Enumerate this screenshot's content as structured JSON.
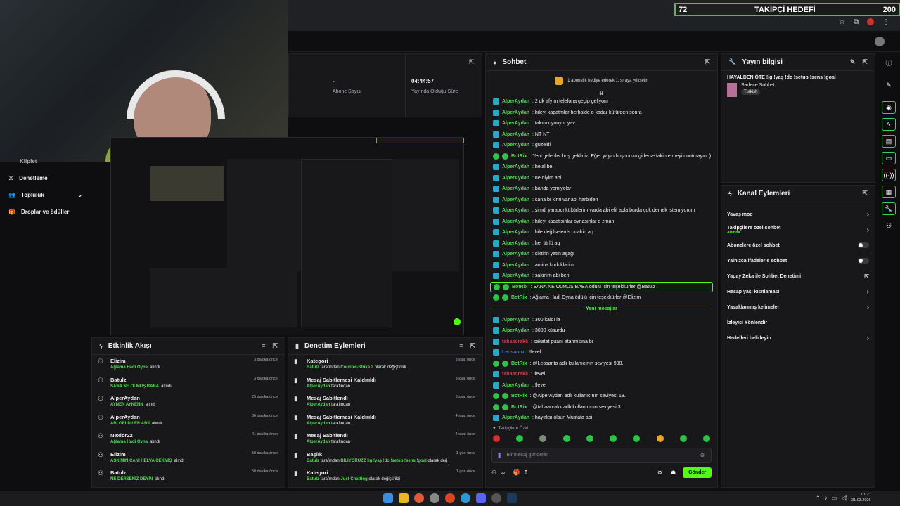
{
  "goal": {
    "current": "72",
    "title": "TAKİPÇİ HEDEFİ",
    "target": "200"
  },
  "left_nav": {
    "items": [
      {
        "label": "Kliplet"
      },
      {
        "label": "Denetleme"
      },
      {
        "label": "Topluluk"
      },
      {
        "label": "Droplar ve ödüller"
      }
    ]
  },
  "stats": {
    "abone_value": "-",
    "abone_label": "Abone Sayısı",
    "time_value": "04:44:57",
    "time_label": "Yayında Olduğu Süre"
  },
  "chat": {
    "title": "Sohbet",
    "gift_banner": "1 abonelik hediye ederek 1. sıraya yükselin",
    "messages": [
      {
        "user": "AlperAydan",
        "text": ": 2 dk afyım telefona geçip geliyom",
        "bot": false
      },
      {
        "user": "AlperAydan",
        "text": ": hileyi kapatmlar herhalde o kadar küfürden sonra",
        "bot": false
      },
      {
        "user": "AlperAydan",
        "text": ": takım oynuyor yav",
        "bot": false
      },
      {
        "user": "AlperAydan",
        "text": ": NT NT",
        "bot": false
      },
      {
        "user": "AlperAydan",
        "text": ": güzeldi",
        "bot": false
      },
      {
        "user": "BotRix",
        "text": ": Yeni gelenler hoş geldiniz. Eğer yayın hoşunuza giderse takip etmeyi unutmayın :)",
        "bot": true
      },
      {
        "user": "AlperAydan",
        "text": ": helal be",
        "bot": false
      },
      {
        "user": "AlperAydan",
        "text": ": ne diyim abi",
        "bot": false
      },
      {
        "user": "AlperAydan",
        "text": ": banda yemiyolar",
        "bot": false
      },
      {
        "user": "AlperAydan",
        "text": ": sana bi kiriri var abi harbiden",
        "bot": false
      },
      {
        "user": "AlperAydan",
        "text": ": şimdi yaratıcı kültürlerim varda abi elif abla burda çok demek istemiyorum",
        "bot": false
      },
      {
        "user": "AlperAydan",
        "text": ": hileyi kaoatisinlar oynasınlar o zman",
        "bot": false
      },
      {
        "user": "AlperAydan",
        "text": ": hile değilselerds onalrin aq",
        "bot": false
      },
      {
        "user": "AlperAydan",
        "text": ": her türlü aq",
        "bot": false
      },
      {
        "user": "AlperAydan",
        "text": ": siktirin yatın aşağı",
        "bot": false
      },
      {
        "user": "AlperAydan",
        "text": ": amina koduklarim",
        "bot": false
      },
      {
        "user": "AlperAydan",
        "text": ": sakinim abi ben",
        "bot": false
      },
      {
        "user": "BotRix",
        "text": ": SANA NE OLMUŞ BABA ödülü için teşekkürler @Batulz",
        "bot": true,
        "highlight": true
      },
      {
        "user": "BotRix",
        "text": ": Ağlama Hadi Oyna ödülü için teşekkürler @Elizim",
        "bot": true
      }
    ],
    "new_messages_label": "Yeni mesajlar",
    "messages2": [
      {
        "user": "AlperAydan",
        "text": ": 300 kaldı la",
        "bot": false,
        "color": "#56d856"
      },
      {
        "user": "AlperAydan",
        "text": ": 3000 küsurdu",
        "bot": false,
        "color": "#56d856"
      },
      {
        "user": "tahaaoraklı",
        "text": ": sakatat puanı atarmısına bı",
        "bot": false,
        "color": "#e0364a"
      },
      {
        "user": "Leosanto",
        "text": ": !level",
        "bot": false,
        "color": "#3b7bf0"
      },
      {
        "user": "BotRix",
        "text": ": @Leosanto adlı kullanıcının seviyesi 998.",
        "bot": true,
        "color": "#56d856"
      },
      {
        "user": "tahaaoraklı",
        "text": ": !level",
        "bot": false,
        "color": "#e0364a"
      },
      {
        "user": "AlperAydan",
        "text": ": !level",
        "bot": false,
        "color": "#56d856"
      },
      {
        "user": "BotRix",
        "text": ": @AlperAydan adlı kullanıcının seviyesi 18.",
        "bot": true,
        "color": "#56d856"
      },
      {
        "user": "BotRix",
        "text": ": @tahaaorakk adlı kullanıcının seviyesi 3.",
        "bot": true,
        "color": "#56d856"
      },
      {
        "user": "AlperAydan",
        "text": ": hayırlısı olsun Mustafa abi",
        "bot": false,
        "color": "#56d856"
      }
    ],
    "followers_only": "Takipçilere Özel",
    "input_placeholder": "Bir mesaj gönderin",
    "points": "0",
    "send_label": "Gönder"
  },
  "stream_info": {
    "title": "Yayın bilgisi",
    "stream_title": "HAYALDEN ÖTE !ig !yaş !dc !setup !sens !goal",
    "category": "Sadece Sohbet",
    "tag": "Turkish"
  },
  "channel_actions": {
    "title": "Kanal Eylemleri",
    "items": [
      {
        "label": "Yavaş mod",
        "sub": "",
        "ctrl": "chevron"
      },
      {
        "label": "Takipçilere özel sohbet",
        "sub": "Anında",
        "ctrl": "chevron"
      },
      {
        "label": "Abonelere özel sohbet",
        "sub": "",
        "ctrl": "toggle"
      },
      {
        "label": "Yalnızca ifadelerle sohbet",
        "sub": "",
        "ctrl": "toggle"
      },
      {
        "label": "Yapay Zeka ile Sohbet Denetimi",
        "sub": "",
        "ctrl": "external"
      },
      {
        "label": "Hesap yaşı kısıtlaması",
        "sub": "",
        "ctrl": "chevron"
      },
      {
        "label": "Yasaklanmış kelimeler",
        "sub": "",
        "ctrl": "chevron"
      },
      {
        "label": "İzleyici Yönlendir",
        "sub": "",
        "ctrl": "none"
      },
      {
        "label": "Hedefleri belirleyin",
        "sub": "",
        "ctrl": "chevron"
      }
    ]
  },
  "activity": {
    "title": "Etkinlik Akışı",
    "items": [
      {
        "user": "Elizim",
        "reward": "Ağlama Hadi Oyna",
        "suffix": "alındı",
        "time": "3 dakika önce"
      },
      {
        "user": "Batulz",
        "reward": "SANA NE OLMUŞ BABA",
        "suffix": "alındı",
        "time": "3 dakika önce"
      },
      {
        "user": "AlperAydan",
        "reward": "AYNEN AYNENN",
        "suffix": "alındı",
        "time": "25 dakika önce"
      },
      {
        "user": "AlperAydan",
        "reward": "ABİ GELDİLER ABİİ",
        "suffix": "alındı",
        "time": "36 dakika önce"
      },
      {
        "user": "Nexlor22",
        "reward": "Ağlama Hadi Oyna",
        "suffix": "alındı",
        "time": "41 dakika önce"
      },
      {
        "user": "Elizim",
        "reward": "AŞKIMIN CANI HELVA ÇEKMİŞ",
        "suffix": "alındı",
        "time": "50 dakika önce"
      },
      {
        "user": "Batulz",
        "reward": "NE DERSENİZ DEYİN",
        "suffix": "alındı",
        "time": "50 dakika önce"
      }
    ]
  },
  "mod_actions": {
    "title": "Denetim Eylemleri",
    "items": [
      {
        "title": "Kategori",
        "actor": "Batulz",
        "mid": " tarafından ",
        "value": "Counter-Strike 2",
        "tail": " olarak değiştirildi",
        "time": "3 saat önce"
      },
      {
        "title": "Mesaj Sabitlemesi Kaldırıldı",
        "actor": "AlperAydan",
        "mid": " tarafından",
        "value": "",
        "tail": "",
        "time": "3 saat önce"
      },
      {
        "title": "Mesaj Sabitlendi",
        "actor": "AlperAydan",
        "mid": " tarafından",
        "value": "",
        "tail": "",
        "time": "3 saat önce"
      },
      {
        "title": "Mesaj Sabitlemesi Kaldırıldı",
        "actor": "AlperAydan",
        "mid": " tarafından",
        "value": "",
        "tail": "",
        "time": "4 saat önce"
      },
      {
        "title": "Mesaj Sabitlendi",
        "actor": "AlperAydan",
        "mid": " tarafından",
        "value": "",
        "tail": "",
        "time": "4 saat önce"
      },
      {
        "title": "Başlık",
        "actor": "Batulz",
        "mid": " tarafından ",
        "value": "BİLİYORUZZ !ig !yaş !dc !setup !sens !goal",
        "tail": " olarak değiştirildi",
        "time": "1 gün önce"
      },
      {
        "title": "Kategori",
        "actor": "Batulz",
        "mid": " tarafından ",
        "value": "Just Chatting",
        "tail": " olarak değiştirildi",
        "time": "1 gün önce"
      }
    ]
  },
  "taskbar": {
    "time": "01:21",
    "date": "31.03.2026"
  }
}
